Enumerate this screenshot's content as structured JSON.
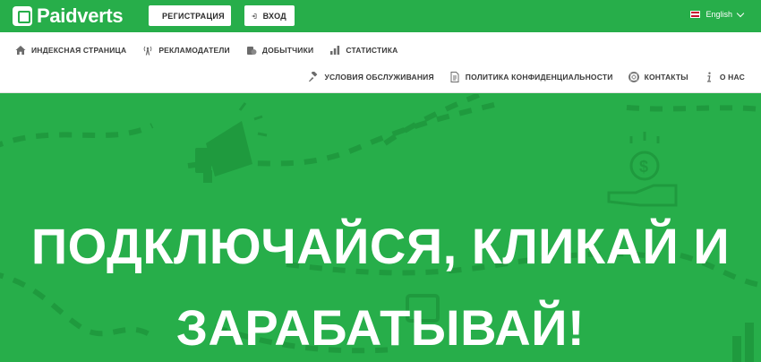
{
  "brand": {
    "name": "Paidverts"
  },
  "header": {
    "register_label": "РЕГИСТРАЦИЯ",
    "login_label": "ВХОД",
    "language": "English"
  },
  "nav": {
    "primary": [
      {
        "label": "ИНДЕКСНАЯ СТРАНИЦА",
        "icon": "home-icon"
      },
      {
        "label": "РЕКЛАМОДАТЕЛИ",
        "icon": "broadcast-icon"
      },
      {
        "label": "ДОБЫТЧИКИ",
        "icon": "coins-icon"
      },
      {
        "label": "СТАТИСТИКА",
        "icon": "bar-chart-icon"
      }
    ],
    "secondary": [
      {
        "label": "УСЛОВИЯ ОБСЛУЖИВАНИЯ",
        "icon": "gavel-icon"
      },
      {
        "label": "ПОЛИТИКА КОНФИДЕНЦИАЛЬНОСТИ",
        "icon": "document-icon"
      },
      {
        "label": "КОНТАКТЫ",
        "icon": "lifebuoy-icon"
      },
      {
        "label": "О НАС",
        "icon": "info-icon"
      }
    ]
  },
  "hero": {
    "line1": "ПОДКЛЮЧАЙСЯ, КЛИКАЙ И",
    "line2": "ЗАРАБАТЫВАЙ!"
  },
  "colors": {
    "brand_green": "#27ae4a",
    "decor_green": "#1f9a3e"
  }
}
